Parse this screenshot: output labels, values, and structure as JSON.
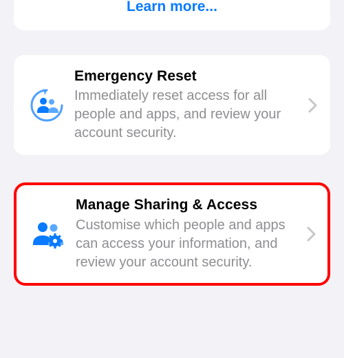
{
  "learn_more": {
    "label": "Learn more..."
  },
  "cards": {
    "emergency": {
      "title": "Emergency Reset",
      "desc": "Immediately reset access for all people and apps, and review your account security."
    },
    "manage": {
      "title": "Manage Sharing & Access",
      "desc": "Customise which people and apps can access your information, and review your account security."
    }
  },
  "colors": {
    "accent": "#0a7aff"
  }
}
